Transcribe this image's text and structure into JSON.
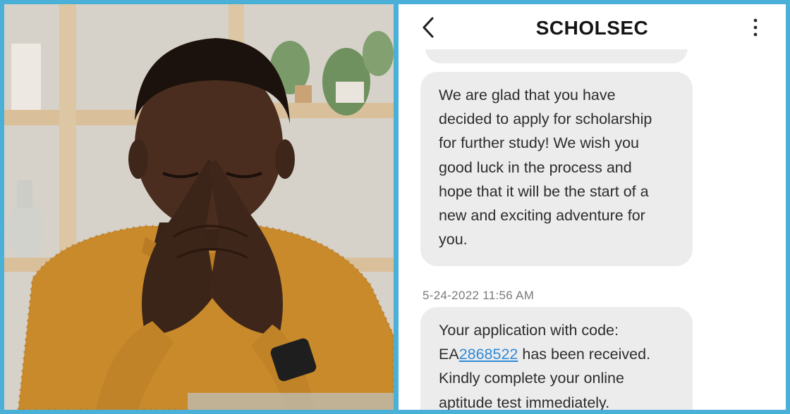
{
  "photo": {
    "subject": "man-in-mustard-sweater-with-hands-on-face"
  },
  "chat": {
    "title": "SCHOLSEC",
    "back_icon": "chevron-left-icon",
    "menu_icon": "more-vertical-icon",
    "message_1_lines": [
      "We are glad that you have",
      "decided to apply for scholarship",
      "for further study! We wish you",
      "good luck in the process and",
      "hope that it will be the start of a",
      "new and exciting adventure for",
      "you."
    ],
    "timestamp": "5-24-2022 11:56 AM",
    "message_2": {
      "line_1": "Your application with code:",
      "code_prefix": "EA",
      "code_number": "2868522",
      "line_2_rest": " has been received.",
      "line_3": "Kindly complete your online",
      "line_4": "aptitude test immediately."
    }
  },
  "colors": {
    "frame": "#4bb0d8",
    "bubble": "#ececec",
    "link": "#2e8ad8",
    "sweater": "#c98a2c"
  }
}
